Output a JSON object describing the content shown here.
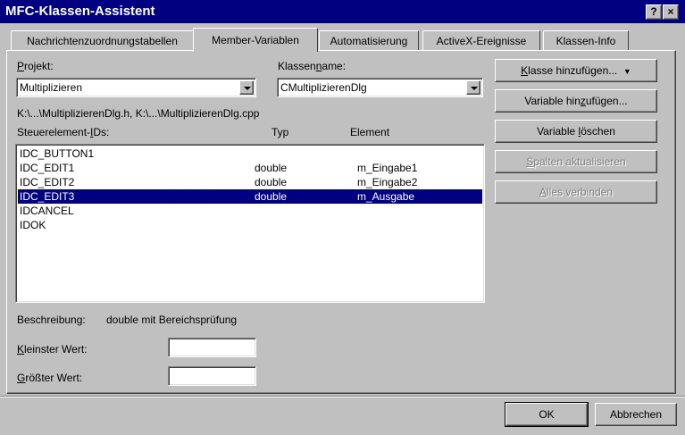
{
  "window": {
    "title": "MFC-Klassen-Assistent",
    "help_label": "?",
    "close_label": "×"
  },
  "tabs": [
    {
      "label": "Nachrichtenzuordnungstabellen",
      "active": false
    },
    {
      "label": "Member-Variablen",
      "active": true
    },
    {
      "label": "Automatisierung",
      "active": false
    },
    {
      "label": "ActiveX-Ereignisse",
      "active": false
    },
    {
      "label": "Klassen-Info",
      "active": false
    }
  ],
  "project": {
    "label_pre": "",
    "label_hot": "P",
    "label_post": "rojekt:",
    "value": "Multiplizieren"
  },
  "classname": {
    "label_pre": "Klassen",
    "label_hot": "n",
    "label_post": "ame:",
    "value": "CMultiplizierenDlg"
  },
  "file_path": "K:\\...\\MultiplizierenDlg.h, K:\\...\\MultiplizierenDlg.cpp",
  "list_headers": {
    "ids_pre": "Steuerelement-",
    "ids_hot": "I",
    "ids_post": "Ds:",
    "type": "Typ",
    "element": "Element"
  },
  "controls": [
    {
      "id": "IDC_BUTTON1",
      "type": "",
      "element": "",
      "selected": false
    },
    {
      "id": "IDC_EDIT1",
      "type": "double",
      "element": "m_Eingabe1",
      "selected": false
    },
    {
      "id": "IDC_EDIT2",
      "type": "double",
      "element": "m_Eingabe2",
      "selected": false
    },
    {
      "id": "IDC_EDIT3",
      "type": "double",
      "element": "m_Ausgabe",
      "selected": true
    },
    {
      "id": "IDCANCEL",
      "type": "",
      "element": "",
      "selected": false
    },
    {
      "id": "IDOK",
      "type": "",
      "element": "",
      "selected": false
    }
  ],
  "buttons": {
    "add_class": {
      "pre": "",
      "hot": "K",
      "post": "lasse hinzufügen...",
      "arrow": "▼"
    },
    "add_variable": {
      "pre": "Variable hin",
      "hot": "z",
      "post": "ufügen..."
    },
    "delete_variable": {
      "pre": "Variable ",
      "hot": "l",
      "post": "öschen"
    },
    "update_columns": {
      "pre": "",
      "hot": "S",
      "post": "palten aktualisieren"
    },
    "bind_all": {
      "pre": "",
      "hot": "A",
      "post": "lles verbinden"
    }
  },
  "description": {
    "label": "Beschreibung:",
    "value": "double mit Bereichsprüfung"
  },
  "min_value": {
    "label_pre": "",
    "label_hot": "K",
    "label_post": "leinster Wert:",
    "value": ""
  },
  "max_value": {
    "label_pre": "",
    "label_hot": "G",
    "label_post": "rößter Wert:",
    "value": ""
  },
  "footer": {
    "ok": "OK",
    "cancel": "Abbrechen"
  },
  "colors": {
    "title_bar": "#000080",
    "face": "#c0c0c0",
    "selection": "#000080"
  }
}
